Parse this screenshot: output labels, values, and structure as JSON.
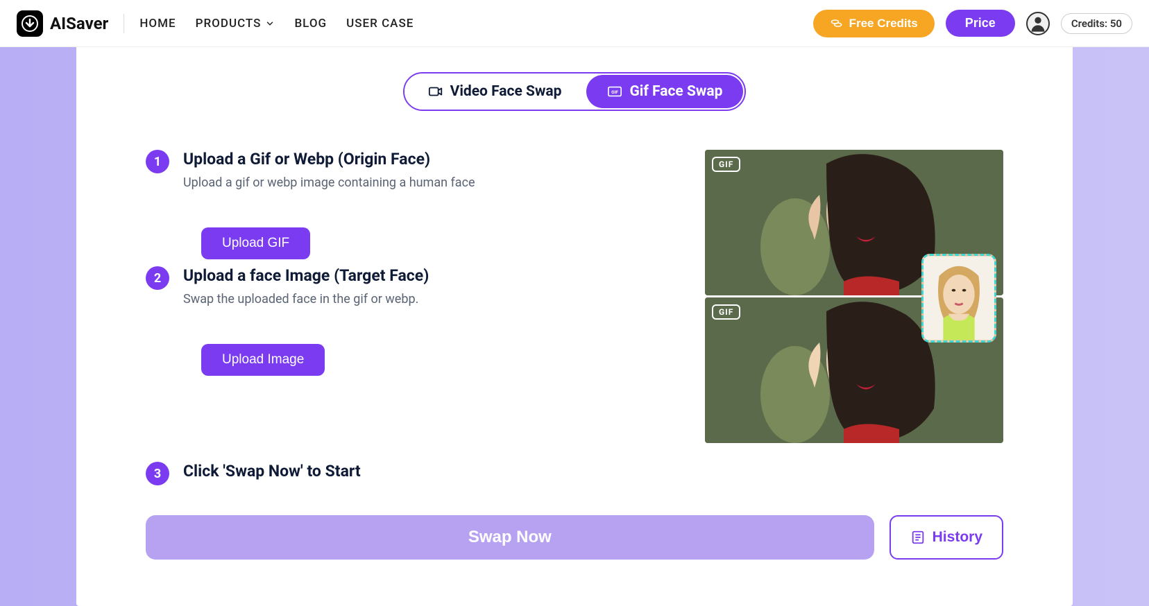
{
  "brand": "AISaver",
  "nav": {
    "home": "HOME",
    "products": "PRODUCTS",
    "blog": "BLOG",
    "usercase": "USER CASE"
  },
  "header": {
    "free_credits": "Free Credits",
    "price": "Price",
    "credits_label": "Credits: 50"
  },
  "tabs": {
    "video": "Video Face Swap",
    "gif": "Gif Face Swap"
  },
  "steps": [
    {
      "num": "1",
      "title": "Upload a Gif or Webp (Origin Face)",
      "desc": "Upload a gif or webp image containing a human face",
      "button": "Upload GIF"
    },
    {
      "num": "2",
      "title": "Upload a face Image (Target Face)",
      "desc": "Swap the uploaded face in the gif or webp.",
      "button": "Upload Image"
    },
    {
      "num": "3",
      "title": "Click 'Swap Now' to Start"
    }
  ],
  "preview": {
    "gif_badge": "GIF"
  },
  "actions": {
    "swap_now": "Swap Now",
    "history": "History"
  }
}
